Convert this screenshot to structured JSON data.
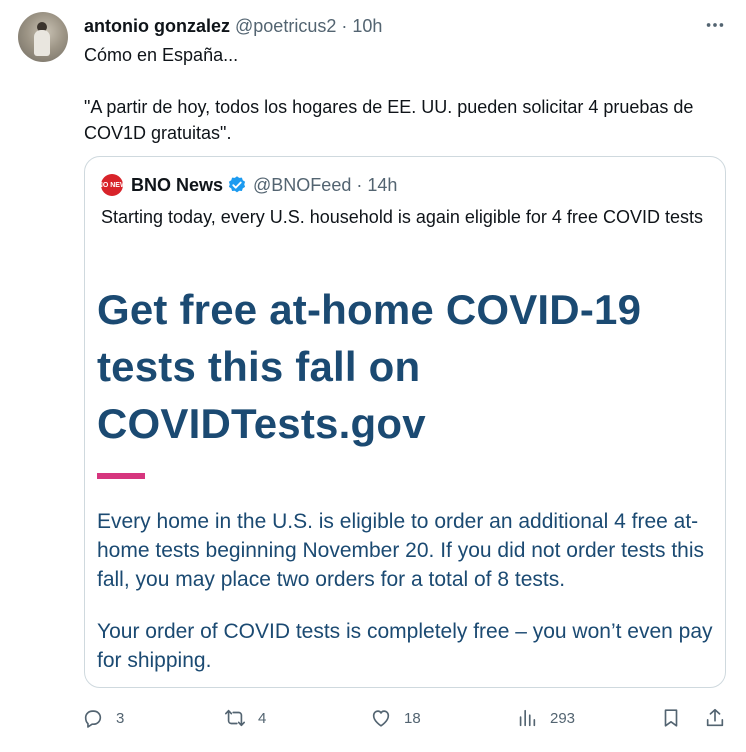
{
  "tweet": {
    "author_name": "antonio gonzalez",
    "author_handle": "@poetricus2",
    "separator": "·",
    "time": "10h",
    "text_line1": "Cómo en España...",
    "text_line2": "\"A partir de hoy, todos los hogares de EE. UU. pueden solicitar 4 pruebas de COV1D gratuitas\"."
  },
  "quote": {
    "logo_text": "BNO NEWS",
    "author_name": "BNO News",
    "author_handle": "@BNOFeed",
    "separator": "·",
    "time": "14h",
    "text": "Starting today, every U.S. household is again eligible for 4 free COVID tests",
    "card": {
      "headline": "Get free at-home COVID-19 tests this fall on COVIDTests.gov",
      "paragraph1": "Every home in the U.S. is eligible to order an additional 4 free at-home tests beginning November 20. If you did not order tests this fall, you may place two orders for a total of 8 tests.",
      "paragraph2": "Your order of COVID tests is completely free – you won’t even pay for shipping."
    }
  },
  "actions": {
    "replies": "3",
    "reposts": "4",
    "likes": "18",
    "views": "293"
  },
  "colors": {
    "verified_badge": "#1d9bf0",
    "headline": "#1b4a72",
    "accent_bar": "#d6357e",
    "bno_logo": "#d8232a",
    "secondary_text": "#536471"
  }
}
